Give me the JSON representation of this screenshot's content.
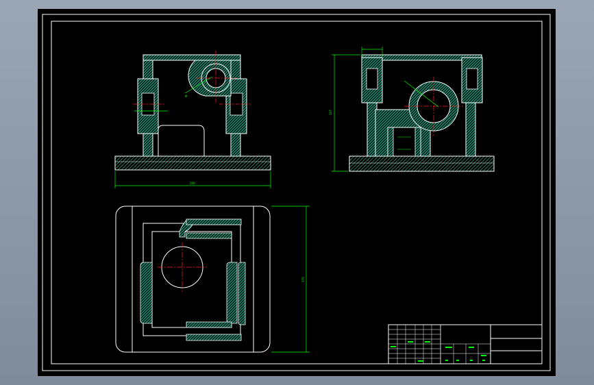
{
  "drawing": {
    "front_view": {
      "width_dim": "200"
    },
    "side_view": {
      "height_dim": "107"
    },
    "top_view": {
      "depth_dim": "170"
    }
  },
  "title_block": {
    "labels": [
      "",
      "",
      "",
      "",
      "",
      "",
      "",
      ""
    ]
  },
  "colors": {
    "background": "#000000",
    "outline": "#ffffff",
    "hatch": "#00d0b0",
    "dimension": "#00ff00",
    "centerline": "#ff2020"
  }
}
